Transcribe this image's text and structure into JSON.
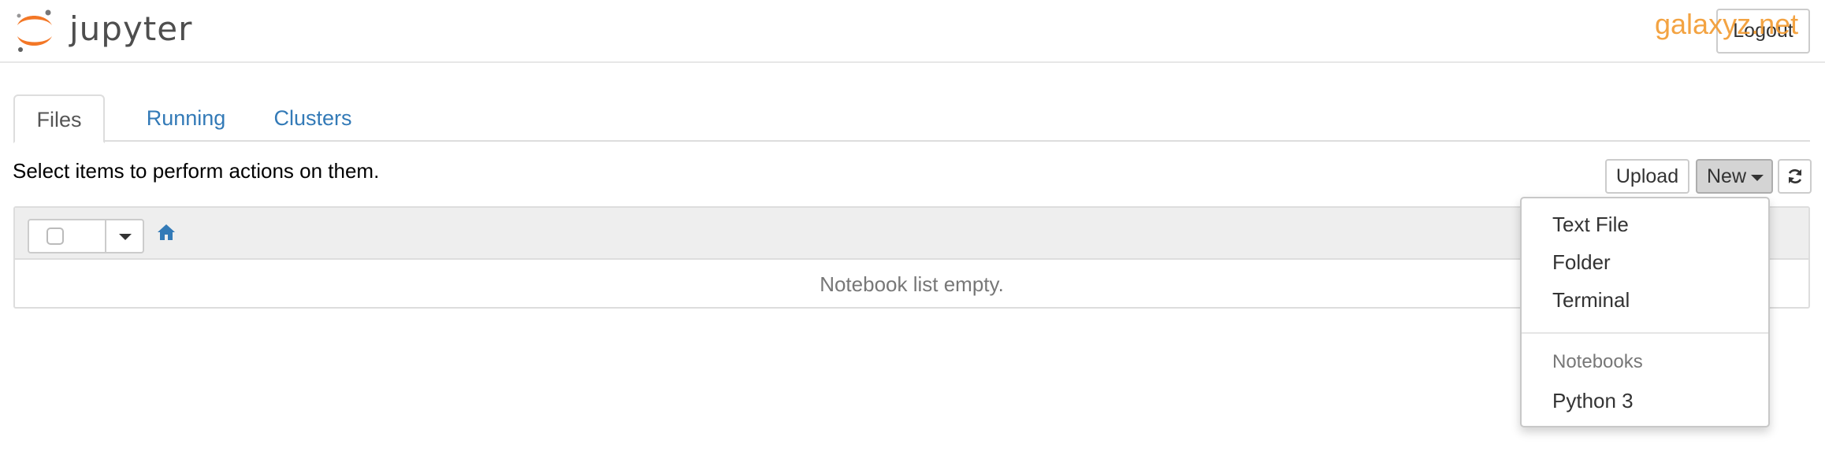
{
  "header": {
    "logo_text": "jupyter",
    "logout_label": "Logout",
    "watermark": "galaxyz.net"
  },
  "tabs": [
    {
      "label": "Files",
      "active": true
    },
    {
      "label": "Running",
      "active": false
    },
    {
      "label": "Clusters",
      "active": false
    }
  ],
  "toolbar": {
    "help_text": "Select items to perform actions on them.",
    "upload_label": "Upload",
    "new_label": "New",
    "refresh_icon": "refresh-icon"
  },
  "file_list": {
    "home_icon": "home-icon",
    "empty_message": "Notebook list empty."
  },
  "new_menu": {
    "items": [
      "Text File",
      "Folder",
      "Terminal"
    ],
    "section_header": "Notebooks",
    "kernels": [
      "Python 3"
    ]
  },
  "colors": {
    "brand_orange": "#f37726",
    "link_blue": "#337ab7",
    "watermark_orange": "#f39c33"
  }
}
